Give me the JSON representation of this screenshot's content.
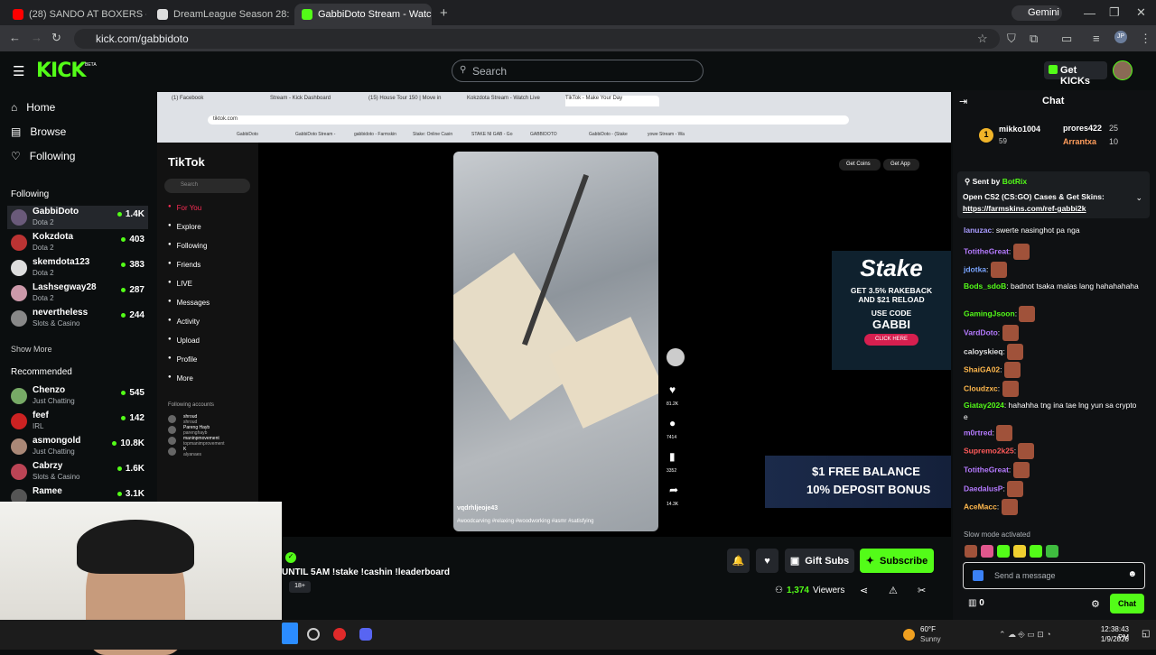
{
  "browser": {
    "tabs": [
      {
        "label": "(28) SANDO AT BOXERS - YouT",
        "color": "#ff0000"
      },
      {
        "label": "DreamLeague Season 28: South",
        "color": "#ffffff"
      },
      {
        "label": "GabbiDoto Stream - Watch",
        "color": "#53fc18"
      }
    ],
    "gemini": "Gemini",
    "url": "kick.com/gabbidoto",
    "profile": "JP"
  },
  "kick": {
    "logo": "KICK",
    "beta": "BETA",
    "search_placeholder": "Search",
    "get_kicks": "Get KICKs",
    "nav": {
      "home": "Home",
      "browse": "Browse",
      "following": "Following"
    },
    "following_header": "Following",
    "following": [
      {
        "name": "GabbiDoto",
        "cat": "Dota 2",
        "viewers": "1.4K",
        "color": "#6a5a7a"
      },
      {
        "name": "Kokzdota",
        "cat": "Dota 2",
        "viewers": "403",
        "color": "#b33"
      },
      {
        "name": "skemdota123",
        "cat": "Dota 2",
        "viewers": "383",
        "color": "#ddd"
      },
      {
        "name": "Lashsegway28",
        "cat": "Dota 2",
        "viewers": "287",
        "color": "#c9a"
      },
      {
        "name": "nevertheless",
        "cat": "Slots & Casino",
        "viewers": "244",
        "color": "#888"
      }
    ],
    "show_more": "Show More",
    "recommended_header": "Recommended",
    "recommended": [
      {
        "name": "Chenzo",
        "cat": "Just Chatting",
        "viewers": "545",
        "color": "#7a6"
      },
      {
        "name": "feef",
        "cat": "IRL",
        "viewers": "142",
        "color": "#c22"
      },
      {
        "name": "asmongold",
        "cat": "Just Chatting",
        "viewers": "10.8K",
        "color": "#a87"
      },
      {
        "name": "Cabrzy",
        "cat": "Slots & Casino",
        "viewers": "1.6K",
        "color": "#b45"
      },
      {
        "name": "Ramee",
        "cat": "",
        "viewers": "3.1K",
        "color": "#555"
      }
    ]
  },
  "stream": {
    "tiktok_tabs": [
      "(1) Facebook",
      "Stream - Kick Dashboard",
      "(15) House Tour 150 | Move in",
      "Kokzdota Stream - Watch Live",
      "TikTok - Make Your Day"
    ],
    "tiktok_url": "tiktok.com",
    "bookmarks": [
      "GabbiDoto",
      "GabbiDoto Stream -",
      "gabbidoto - Farmskin",
      "Stake: Online Casin",
      "STAKE NI GAB - Go",
      "GABBIDOTO",
      "GabbiDoto - (Stake",
      "yowe Stream - Wa"
    ],
    "tiktok_logo": "TikTok",
    "tiktok_search": "Search",
    "tiktok_menu": [
      "For You",
      "Explore",
      "Following",
      "Friends",
      "LIVE",
      "Messages",
      "Activity",
      "Upload",
      "Profile",
      "More"
    ],
    "following_accounts_header": "Following accounts",
    "following_accounts": [
      [
        "shroud",
        "shroud"
      ],
      [
        "Pareng Hayb",
        "parenghayb"
      ],
      [
        "maninpmovement",
        "topmanimprovement"
      ],
      [
        "K",
        "alyanaes"
      ]
    ],
    "get_coins": "Get Coins",
    "get_app": "Get App",
    "video_user": "vqdrhljeoje43",
    "video_tags": "#woodcarving #relaxing #woodworking #asmr #satisfying",
    "counts": [
      "81.2K",
      "7414",
      "3352",
      "14.3K"
    ],
    "stake_ad": {
      "brand": "Stake",
      "line1": "GET 3.5% RAKEBACK",
      "line2": "AND $21 RELOAD",
      "line3": "USE CODE",
      "code": "GABBI",
      "cta": "CLICK HERE"
    },
    "bonus_ad": {
      "line1": "$1 FREE BALANCE",
      "line2": "10% DEPOSIT BONUS"
    }
  },
  "info": {
    "title": "UNTIL 5AM !stake !cashin !leaderboard",
    "age": "18+",
    "gift": "Gift Subs",
    "subscribe": "Subscribe",
    "viewers": "1,374",
    "viewers_label": "Viewers"
  },
  "chat": {
    "header": "Chat",
    "leaders": [
      {
        "name": "mikko1004",
        "val": "59",
        "rank": "1"
      },
      {
        "name": "prores422",
        "val": "25"
      },
      {
        "name": "Arrantxa",
        "val": "10"
      }
    ],
    "pinned_by": "Sent by",
    "pinned_bot": "BotRix",
    "pinned_text": "Open CS2 (CS:GO) Cases & Get Skins:",
    "pinned_link": "https://farmskins.com/ref-gabbi2k",
    "messages": [
      {
        "user": "lanuzac",
        "text": "swerte nasinghot pa nga",
        "color": "#a99cff"
      },
      {
        "user": "TotitheGreat",
        "text": "",
        "color": "#b57aff"
      },
      {
        "user": "jdotka",
        "text": "",
        "color": "#7aa5ff"
      },
      {
        "user": "Bods_sdoB",
        "text": "badnot tsaka malas lang hahahahaha",
        "color": "#53fc18"
      },
      {
        "user": "GamingJsoon",
        "text": "",
        "color": "#53fc18"
      },
      {
        "user": "VardDoto",
        "text": "",
        "color": "#b57aff"
      },
      {
        "user": "caloyskieq",
        "text": "",
        "color": "#e0e0e0"
      },
      {
        "user": "ShaiGA02",
        "text": "",
        "color": "#ffb84d"
      },
      {
        "user": "Cloudzxc",
        "text": "",
        "color": "#ffb84d"
      },
      {
        "user": "Giatay2024",
        "text": "hahahha tng ina tae lng yun sa crypto e",
        "color": "#53fc18"
      },
      {
        "user": "m0rtred",
        "text": "",
        "color": "#b57aff"
      },
      {
        "user": "Supremo2k25",
        "text": "",
        "color": "#ff5a5a"
      },
      {
        "user": "TotitheGreat",
        "text": "",
        "color": "#b57aff"
      },
      {
        "user": "DaedalusP",
        "text": "",
        "color": "#b57aff"
      },
      {
        "user": "AceMacc",
        "text": "",
        "color": "#ffb84d"
      }
    ],
    "slow_mode": "Slow mode activated",
    "placeholder": "Send a message",
    "points": "0",
    "send": "Chat"
  },
  "taskbar": {
    "temp": "60°F",
    "weather": "Sunny",
    "time": "12:38:43 PM",
    "date": "1/9/2026"
  }
}
